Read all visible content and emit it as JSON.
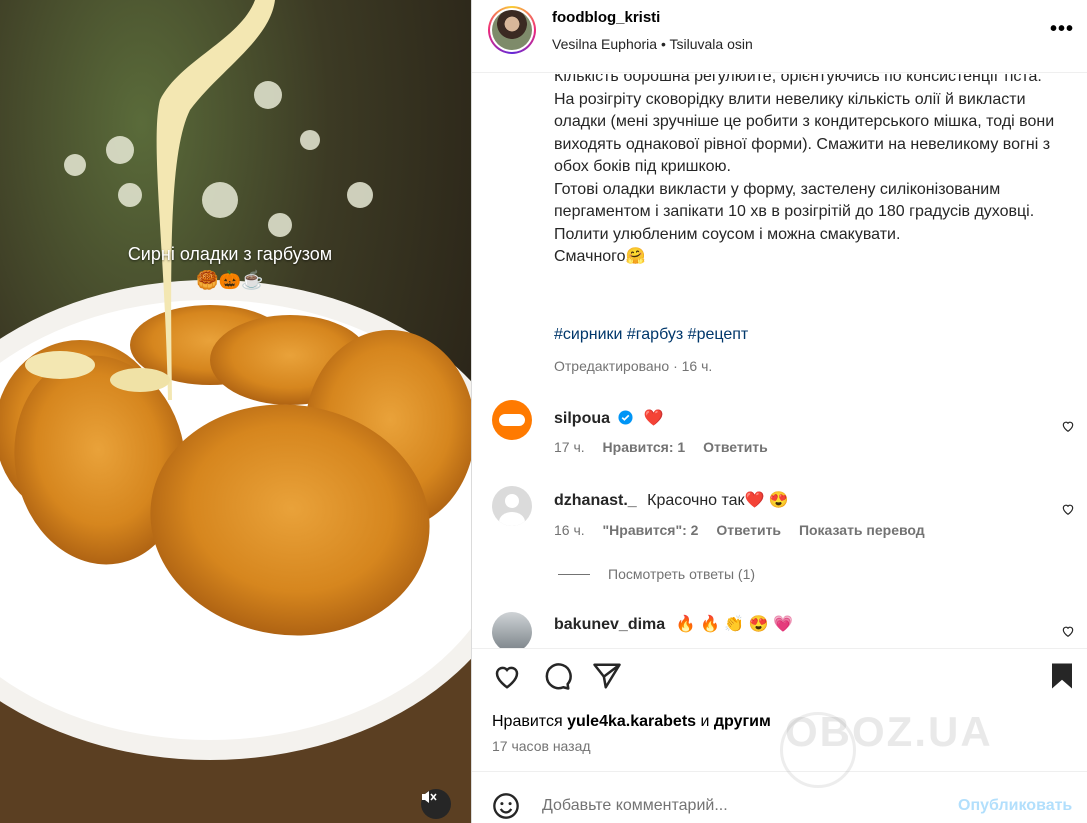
{
  "post": {
    "overlay_title": "Сирні оладки з гарбузом",
    "overlay_emoji": "🥮🎃☕"
  },
  "header": {
    "username": "foodblog_kristi",
    "audio": "Vesilna Euphoria • Tsiluvala osin",
    "more_label": "•••"
  },
  "caption": {
    "text": "Кількість борошна регулюйте, орієнтуючись по консистенції тіста.\nНа розігріту сковорідку влити невелику кількість олії й викласти оладки (мені зручніше це робити з кондитерського мішка, тоді вони виходять однакової рівної форми). Смажити на невеликому вогні з обох боків під кришкою.\nГотові оладки викласти у форму, застелену силіконізованим пергаментом і запікати 10 хв в розігрітій до 180 градусів духовці.\nПолити улюбленим соусом і можна смакувати.\nСмачного🤗",
    "hashtags": "#сирники #гарбуз #рецепт",
    "edited": "Отредактировано · 16 ч."
  },
  "comments": [
    {
      "user": "silpoua",
      "text": "❤️",
      "time": "17 ч.",
      "likes": "Нравится: 1",
      "reply": "Ответить",
      "verified": true
    },
    {
      "user": "dzhanast._",
      "text": "Красочно так❤️ 😍",
      "time": "16 ч.",
      "likes": "\"Нравится\": 2",
      "reply": "Ответить",
      "translate": "Показать перевод",
      "view_replies": "Посмотреть ответы (1)"
    },
    {
      "user": "bakunev_dima",
      "text": "🔥 🔥 👏 😍 💗"
    }
  ],
  "actions": {
    "likes_prefix": "Нравится",
    "likes_user": "yule4ka.karabets",
    "likes_and": "и",
    "likes_others": "другим",
    "time": "17 часов назад"
  },
  "comment_box": {
    "placeholder": "Добавьте комментарий...",
    "publish": "Опубликовать"
  },
  "watermark": "OBOZ.UA",
  "icons": {
    "comment_emoji": "smiley-icon",
    "like": "heart-icon",
    "comment": "comment-icon",
    "share": "share-icon",
    "save": "bookmark-icon",
    "mute": "speaker-muted-icon"
  },
  "colors": {
    "link": "#00376b",
    "secondary_text": "#737373",
    "publish_disabled": "#b2dffc",
    "like_red": "#ed4956"
  }
}
